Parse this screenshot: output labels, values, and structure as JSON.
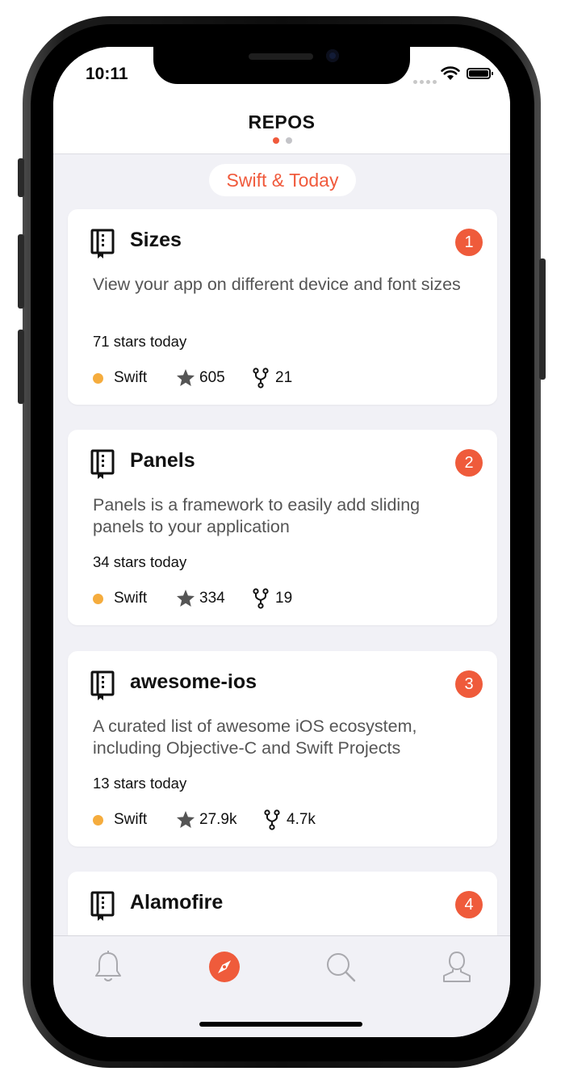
{
  "colors": {
    "accent": "#f05a3c",
    "swift_lang": "#f5ac3d",
    "badge": "#ef5b3b",
    "dot_inactive": "#c4c4c8"
  },
  "status_bar": {
    "time": "10:11"
  },
  "header": {
    "title": "REPOS",
    "pages": 2,
    "active_page": 0
  },
  "section": {
    "label": "Swift & Today"
  },
  "repos": [
    {
      "rank": "1",
      "name": "Sizes",
      "description": "View your app on different device and font sizes",
      "stars_today": "71 stars today",
      "language": "Swift",
      "stars": "605",
      "forks": "21"
    },
    {
      "rank": "2",
      "name": "Panels",
      "description": "Panels is a framework to easily add sliding panels to your application",
      "stars_today": "34 stars today",
      "language": "Swift",
      "stars": "334",
      "forks": "19"
    },
    {
      "rank": "3",
      "name": "awesome-ios",
      "description": "A curated list of awesome iOS ecosystem, including Objective-C and Swift Projects",
      "stars_today": "13 stars today",
      "language": "Swift",
      "stars": "27.9k",
      "forks": "4.7k"
    },
    {
      "rank": "4",
      "name": "Alamofire"
    }
  ],
  "tabs": [
    {
      "icon": "bell-icon",
      "active": false
    },
    {
      "icon": "compass-icon",
      "active": true
    },
    {
      "icon": "search-icon",
      "active": false
    },
    {
      "icon": "profile-icon",
      "active": false
    }
  ]
}
